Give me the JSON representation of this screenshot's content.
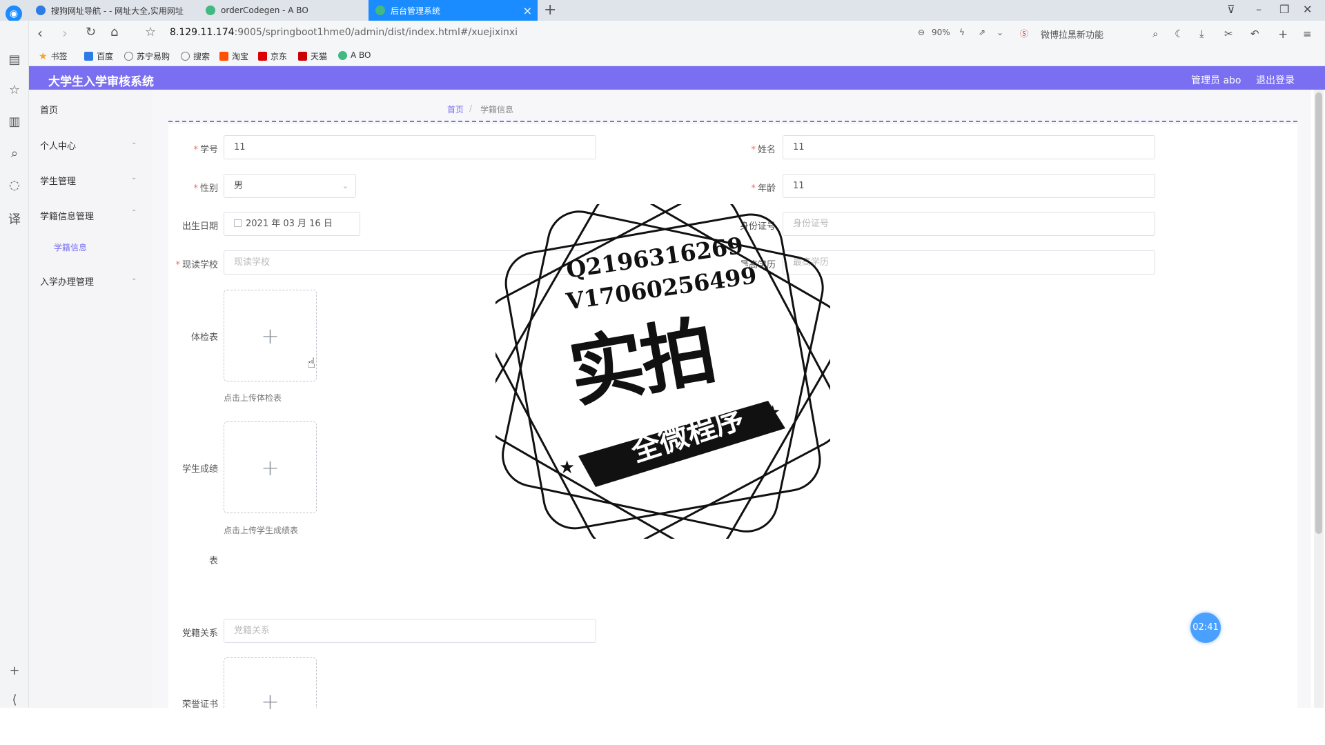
{
  "browser": {
    "tabs": [
      {
        "label": "搜狗网址导航 - - 网址大全,实用网址"
      },
      {
        "label": "orderCodegen - A BO"
      },
      {
        "label": "后台管理系统"
      }
    ],
    "url_host": "8.129.11.174",
    "url_path": ":9005/springboot1hme0/admin/dist/index.html#/xuejixinxi",
    "zoom": "90%",
    "search_hint": "微博拉黑新功能",
    "bookmarks": [
      "书签",
      "百度",
      "苏宁易购",
      "搜索",
      "淘宝",
      "京东",
      "天猫",
      "A BO"
    ]
  },
  "app": {
    "title": "大学生入学审核系统",
    "user_label": "管理员 abo",
    "logout": "退出登录",
    "accent": "#7a6ff0"
  },
  "menu": {
    "home": "首页",
    "personal": "个人中心",
    "student_mgmt": "学生管理",
    "xueji_mgmt": "学籍信息管理",
    "xueji_info": "学籍信息",
    "enroll_mgmt": "入学办理管理"
  },
  "breadcrumb": {
    "home": "首页",
    "sep": "/",
    "current": "学籍信息"
  },
  "form": {
    "student_no": {
      "label": "学号",
      "value": "11"
    },
    "name": {
      "label": "姓名",
      "value": "11"
    },
    "gender": {
      "label": "性别",
      "value": "男"
    },
    "age": {
      "label": "年龄",
      "value": "11"
    },
    "birth": {
      "label": "出生日期",
      "value": "2021 年 03 月 16 日"
    },
    "id_card": {
      "label": "身份证号",
      "placeholder": "身份证号"
    },
    "school": {
      "label": "现读学校",
      "placeholder": "现读学校"
    },
    "education": {
      "label": "最高学历",
      "placeholder": "最高学历"
    },
    "physical": {
      "label": "体检表",
      "hint": "点击上传体检表"
    },
    "scores": {
      "label": "学生成绩",
      "label2": "表",
      "hint": "点击上传学生成绩表"
    },
    "party": {
      "label": "党籍关系",
      "placeholder": "党籍关系"
    },
    "honor": {
      "label": "荣誉证书"
    }
  },
  "timer": "02:41",
  "watermark": {
    "line1": "Q2196316269",
    "line2": "V17060256499",
    "big": "实拍",
    "ribbon": "全微程序"
  }
}
